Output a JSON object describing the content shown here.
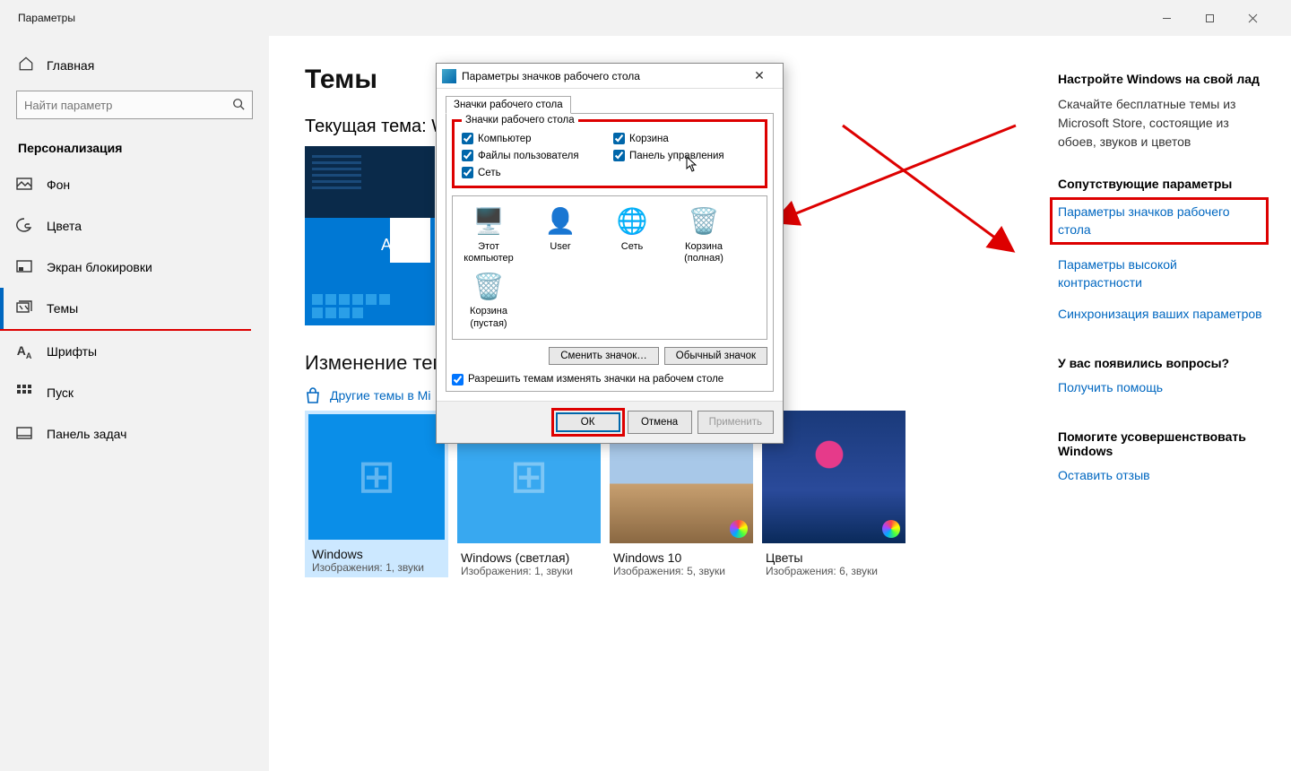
{
  "window": {
    "title": "Параметры"
  },
  "sidebar": {
    "home": "Главная",
    "search_placeholder": "Найти параметр",
    "section": "Персонализация",
    "items": [
      {
        "label": "Фон"
      },
      {
        "label": "Цвета"
      },
      {
        "label": "Экран блокировки"
      },
      {
        "label": "Темы"
      },
      {
        "label": "Шрифты"
      },
      {
        "label": "Пуск"
      },
      {
        "label": "Панель задач"
      }
    ]
  },
  "main": {
    "heading": "Темы",
    "current_theme_label": "Текущая тема: W",
    "change_theme": "Изменение темы",
    "store_link": "Другие темы в Mi",
    "themes": [
      {
        "name": "Windows",
        "meta": "Изображения: 1, звуки"
      },
      {
        "name": "Windows (светлая)",
        "meta": "Изображения: 1, звуки"
      },
      {
        "name": "Windows 10",
        "meta": "Изображения: 5, звуки"
      },
      {
        "name": "Цветы",
        "meta": "Изображения: 6, звуки"
      }
    ]
  },
  "right": {
    "h1": "Настройте Windows на свой лад",
    "p1": "Скачайте бесплатные темы из Microsoft Store, состоящие из обоев, звуков и цветов",
    "h2": "Сопутствующие параметры",
    "link_desktop_icons": "Параметры значков рабочего стола",
    "link_contrast": "Параметры высокой контрастности",
    "link_sync": "Синхронизация ваших параметров",
    "h3": "У вас появились вопросы?",
    "link_help": "Получить помощь",
    "h4": "Помогите усовершенствовать Windows",
    "link_feedback": "Оставить отзыв"
  },
  "dialog": {
    "title": "Параметры значков рабочего стола",
    "tab": "Значки рабочего стола",
    "fieldset_legend": "Значки рабочего стола",
    "checks": {
      "computer": "Компьютер",
      "recycle": "Корзина",
      "userfiles": "Файлы пользователя",
      "cpanel": "Панель управления",
      "network": "Сеть"
    },
    "icons": {
      "this_pc": "Этот компьютер",
      "user": "User",
      "network": "Сеть",
      "bin_full": "Корзина (полная)",
      "bin_empty": "Корзина (пустая)"
    },
    "change_icon": "Сменить значок…",
    "default_icon": "Обычный значок",
    "allow_themes": "Разрешить темам изменять значки на рабочем столе",
    "ok": "ОК",
    "cancel": "Отмена",
    "apply": "Применить"
  }
}
